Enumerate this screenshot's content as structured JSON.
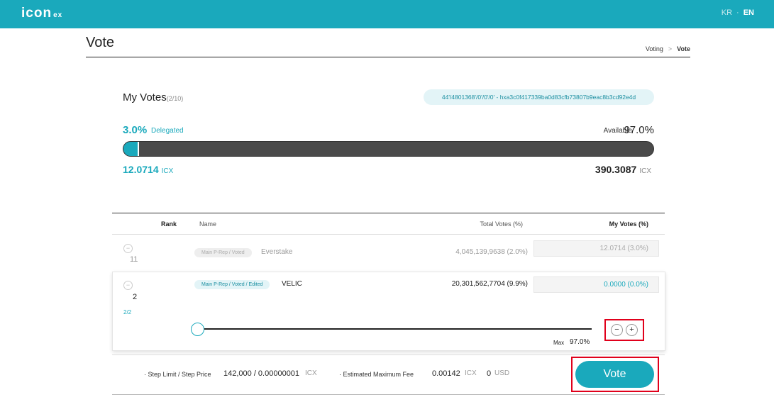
{
  "header": {
    "logo_main": "icon",
    "logo_sub": "ex",
    "lang_kr": "KR",
    "lang_sep": "·",
    "lang_en": "EN"
  },
  "page": {
    "title": "Vote",
    "breadcrumb": [
      "Voting",
      "Vote"
    ],
    "breadcrumb_sep": ">"
  },
  "my_votes": {
    "title": "My Votes",
    "count": "(2/10)",
    "address": "44'/4801368'/0'/0'/0' - hxa3c0f417339ba0d83cfb73807b9eac8b3cd92e4d",
    "delegated_pct": "3.0%",
    "delegated_label": "Delegated",
    "available_label": "Available",
    "available_pct": "97.0%",
    "delegated_fraction": 0.03,
    "delegated_icx": "12.0714",
    "available_icx": "390.3087",
    "unit": "ICX"
  },
  "table": {
    "headers": {
      "rank": "Rank",
      "name": "Name",
      "total": "Total Votes (%)",
      "mine": "My Votes (%)"
    },
    "rows": [
      {
        "rank": "11",
        "tag": "Main P-Rep / Voted",
        "name": "Everstake",
        "total": "4,045,139,9638 (2.0%)",
        "my_votes": "12.0714 (3.0%)"
      },
      {
        "rank": "2",
        "tag": "Main P-Rep / Voted / Edited",
        "name": "VELIC",
        "total": "20,301,562,7704 (9.9%)",
        "my_votes": "0.0000 (0.0%)",
        "pager": "2/2",
        "slider_fraction": 0.0,
        "max_label": "Max",
        "max_value": "97.0%"
      }
    ]
  },
  "footer": {
    "step_label": "· Step Limit / Step Price",
    "step_value": "142,000 / 0.00000001",
    "step_unit": "ICX",
    "fee_label": "· Estimated Maximum Fee",
    "fee_value": "0.00142",
    "fee_unit": "ICX",
    "usd_value": "0",
    "usd_unit": "USD",
    "vote_button": "Vote"
  },
  "icons": {
    "collapse": "−",
    "minus": "−",
    "plus": "+"
  },
  "colors": {
    "accent": "#1aa9bc",
    "highlight": "#e0001b"
  }
}
